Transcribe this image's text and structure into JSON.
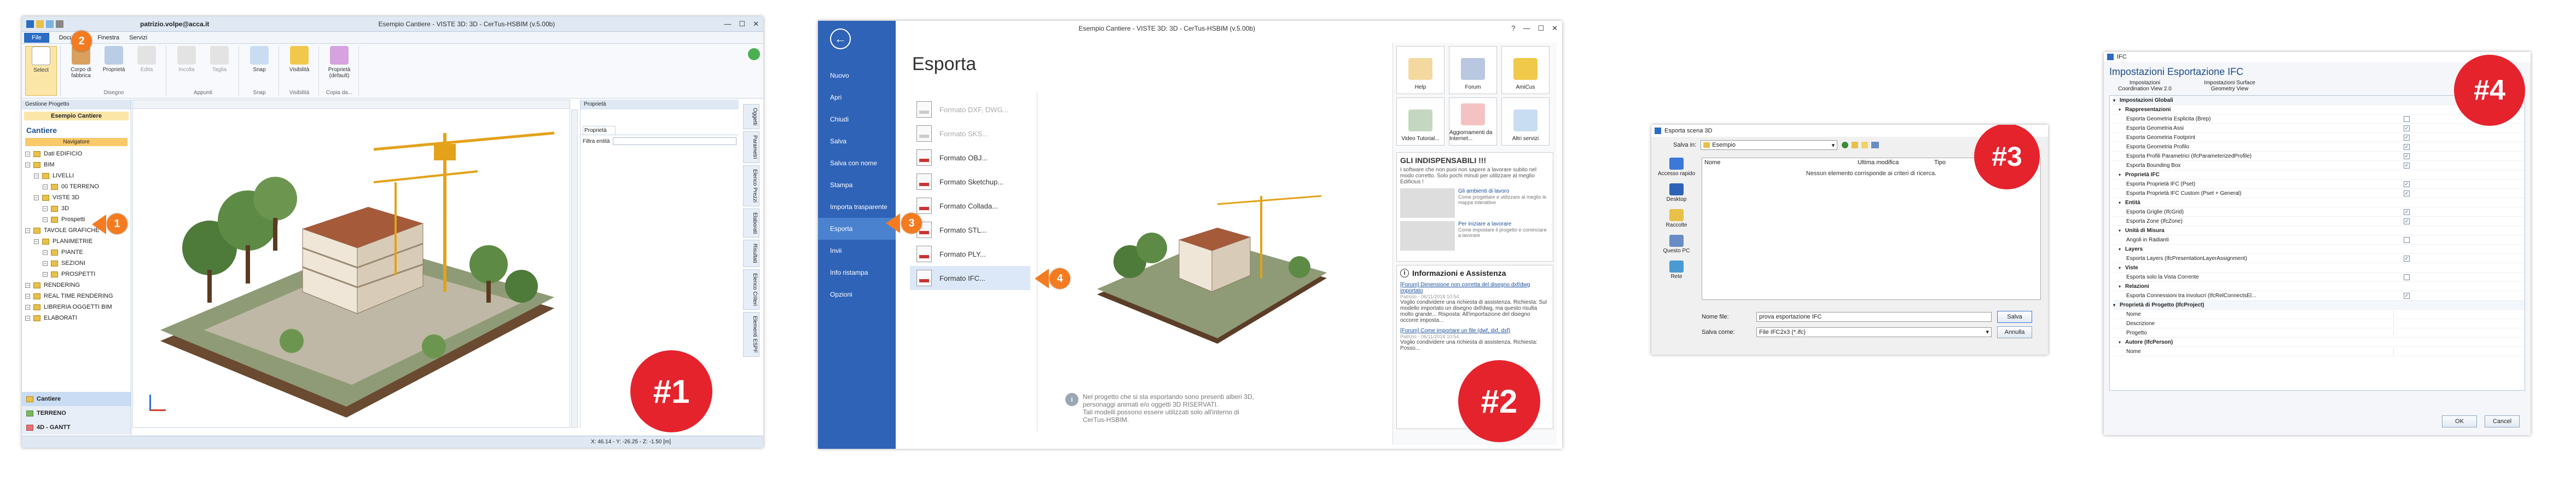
{
  "panel1": {
    "user": "patrizio.volpe@acca.it",
    "title": "Esempio Cantiere - VISTE 3D: 3D - CerTus-HSBIM (v.5.00b)",
    "tabs": [
      "File",
      "Documenti",
      "Finestra",
      "Servizi"
    ],
    "ribbon": {
      "groups": [
        {
          "label": "",
          "buttons": [
            "Select"
          ]
        },
        {
          "label": "Disegno",
          "buttons": [
            "Corpo di fabbrica",
            "Proprietà",
            "Edita"
          ]
        },
        {
          "label": "Appunti",
          "buttons": [
            "Incolla",
            "Taglia"
          ]
        },
        {
          "label": "Snap",
          "buttons": [
            "Snap"
          ]
        },
        {
          "label": "Visibilità",
          "buttons": [
            "Visibilità"
          ]
        },
        {
          "label": "Copia da...",
          "buttons": [
            "Proprietà (default)"
          ]
        }
      ]
    },
    "left_panel": {
      "header": "Gestione Progetto",
      "project": "Esempio Cantiere",
      "section_title": "Cantiere",
      "nav_tab": "Navigatore",
      "tree": [
        {
          "label": "Dati EDIFICIO",
          "level": 0
        },
        {
          "label": "BIM",
          "level": 0
        },
        {
          "label": "LIVELLI",
          "level": 1
        },
        {
          "label": "00 TERRENO",
          "level": 2
        },
        {
          "label": "VISTE 3D",
          "level": 1
        },
        {
          "label": "3D",
          "level": 2
        },
        {
          "label": "Prospetti",
          "level": 2
        },
        {
          "label": "TAVOLE GRAFICHE",
          "level": 0
        },
        {
          "label": "PLANIMETRIE",
          "level": 1
        },
        {
          "label": "PIANTE",
          "level": 2
        },
        {
          "label": "SEZIONI",
          "level": 2
        },
        {
          "label": "PROSPETTI",
          "level": 2
        },
        {
          "label": "RENDERING",
          "level": 0
        },
        {
          "label": "REAL TIME RENDERING",
          "level": 0
        },
        {
          "label": "LIBRERIA OGGETTI BIM",
          "level": 0
        },
        {
          "label": "ELABORATI",
          "level": 0
        }
      ],
      "bottom_items": [
        "Cantiere",
        "TERRENO",
        "4D - GANTT"
      ]
    },
    "properties": {
      "header": "Proprietà",
      "tab": "Proprietà",
      "filter_label": "Filtra entità"
    },
    "right_tabs": [
      "Oggetti",
      "Parametri",
      "Elenco Prezzi",
      "Elaborati",
      "Risultati",
      "Elenco Criteri",
      "Elementi ESPF"
    ],
    "status": "X: 46.14 - Y: -26.25 - Z: -1.50 [m]",
    "steps": [
      "1",
      "2"
    ],
    "badge": "#1"
  },
  "panel2": {
    "title": "Esempio Cantiere - VISTE 3D: 3D - CerTus-HSBIM (v.5.00b)",
    "heading": "Esporta",
    "menu": [
      "Nuovo",
      "Apri",
      "Chiudi",
      "Salva",
      "Salva con nome",
      "Stampa",
      "Importa trasparente",
      "Esporta",
      "Invii",
      "Info ristampa",
      "Opzioni"
    ],
    "formats": [
      {
        "label": "Formato DXF, DWG...",
        "enabled": false
      },
      {
        "label": "Formato SKS...",
        "enabled": false
      },
      {
        "label": "Formato OBJ...",
        "enabled": true
      },
      {
        "label": "Formato Sketchup...",
        "enabled": true
      },
      {
        "label": "Formato Collada...",
        "enabled": true
      },
      {
        "label": "Formato STL...",
        "enabled": true
      },
      {
        "label": "Formato PLY...",
        "enabled": true
      },
      {
        "label": "Formato IFC...",
        "enabled": true
      }
    ],
    "info_text_1": "Nel progetto che si sta esportando sono presenti alberi 3D, personaggi animati e/o oggetti 3D RISERVATI.",
    "info_text_2": "Tali modelli possono essere utilizzati solo all'interno di CerTus-HSBIM.",
    "tiles": [
      {
        "label": "Help"
      },
      {
        "label": "Forum"
      },
      {
        "label": "AmiCus"
      },
      {
        "label": "Video Tutorial..."
      },
      {
        "label": "Aggiornamenti da Internet..."
      },
      {
        "label": "Altri servizi"
      }
    ],
    "indispensabili_title": "GLI INDISPENSABILI !!!",
    "indispensabili_text": "I software che non puoi non sapere a lavorare subito nel modo corretto. Solo pochi minuti per utilizzare al meglio Edificius !",
    "card1": "Gli ambienti di lavoro",
    "card1_text": "Come progettare e utilizzare al meglio le mappe interattive",
    "card2": "Per iniziare a lavorare",
    "card2_text": "Come impostare il progetto e cominciare a lavorare",
    "news_title": "Informazioni e Assistenza",
    "news": [
      {
        "link": "[Forum] Dimensione non corretta del disegno dxf/dwg importato",
        "author": "Patrizio - 06/11/2018 10:54",
        "text": "Voglio condividere una richiesta di assistenza. Richiesta: Sul modello importato un disegno dxf/dwg, ma questo risulta molto grande... Risposta: All'importazione del disegno occorre imposta..."
      },
      {
        "link": "[Forum] Come importare un file (dwf, dxf, dxf)",
        "author": "Patrizio - 06/11/2018 10:54",
        "text": "Voglio condividere una richiesta di assistenza. Richiesta: Posso..."
      }
    ],
    "steps": [
      "3",
      "4"
    ],
    "badge": "#2"
  },
  "panel3": {
    "title": "Esporta scena 3D",
    "save_in_label": "Salva in:",
    "save_in_value": "Esempio",
    "columns": [
      "Nome",
      "Ultima modifica",
      "Tipo"
    ],
    "empty_message": "Nessun elemento corrisponde ai criteri di ricerca.",
    "places": [
      "Accesso rapido",
      "Desktop",
      "Raccolte",
      "Questo PC",
      "Rete"
    ],
    "filename_label": "Nome file:",
    "filename_value": "prova esportazione IFC",
    "filetype_label": "Salva come:",
    "filetype_value": "File IFC2x3 (*.ifc)",
    "save_button": "Salva",
    "cancel_button": "Annulla",
    "badge": "#3"
  },
  "panel4": {
    "title": "IFC",
    "heading": "Impostazioni Esportazione IFC",
    "header_tabs": [
      {
        "label": "Impostazioni Coordination View 2.0"
      },
      {
        "label": "Impostazioni Surface Geometry View"
      }
    ],
    "rows": [
      {
        "label": "Impostazioni Globali",
        "type": "group",
        "checked": null
      },
      {
        "label": "Rappresentazioni",
        "type": "sub",
        "checked": null
      },
      {
        "label": "Esporta Geometria Esplicita (Brep)",
        "type": "row",
        "checked": false
      },
      {
        "label": "Esporta Geometria Assi",
        "type": "row",
        "checked": true
      },
      {
        "label": "Esporta Geometria Footprint",
        "type": "row",
        "checked": true
      },
      {
        "label": "Esporta Geometria Profilo",
        "type": "row",
        "checked": true
      },
      {
        "label": "Esporta Profili Parametrici (IfcParameterizedProfile)",
        "type": "row",
        "checked": true
      },
      {
        "label": "Esporta Bounding Box",
        "type": "row",
        "checked": true
      },
      {
        "label": "Proprietà IFC",
        "type": "sub",
        "checked": null
      },
      {
        "label": "Esporta Proprietà IFC (Pset)",
        "type": "row",
        "checked": true
      },
      {
        "label": "Esporta Proprietà IFC Custom (Pset + General)",
        "type": "row",
        "checked": true
      },
      {
        "label": "Entità",
        "type": "sub",
        "checked": null
      },
      {
        "label": "Esporta Griglie (IfcGrid)",
        "type": "row",
        "checked": true
      },
      {
        "label": "Esporta Zone (IfcZone)",
        "type": "row",
        "checked": true
      },
      {
        "label": "Unità di Misura",
        "type": "sub",
        "checked": null
      },
      {
        "label": "Angoli in Radianti",
        "type": "row",
        "checked": false
      },
      {
        "label": "Layers",
        "type": "sub",
        "checked": null
      },
      {
        "label": "Esporta Layers (IfcPresentationLayerAssignment)",
        "type": "row",
        "checked": true
      },
      {
        "label": "Viste",
        "type": "sub",
        "checked": null
      },
      {
        "label": "Esporta solo la Vista Corrente",
        "type": "row",
        "checked": false
      },
      {
        "label": "Relazioni",
        "type": "sub",
        "checked": null
      },
      {
        "label": "Esporta Connessioni tra involucri (IfcRelConnectsEl...",
        "type": "row",
        "checked": true
      },
      {
        "label": "Proprietà di Progetto (IfcProject)",
        "type": "group",
        "checked": null
      },
      {
        "label": "Nome",
        "type": "field",
        "checked": null
      },
      {
        "label": "Descrizione",
        "type": "field",
        "checked": null
      },
      {
        "label": "Progetto",
        "type": "field",
        "checked": null
      },
      {
        "label": "Autore (IfcPerson)",
        "type": "sub",
        "checked": null
      },
      {
        "label": "Nome",
        "type": "field",
        "checked": null
      }
    ],
    "ok_button": "OK",
    "cancel_button": "Cancel",
    "badge": "#4"
  },
  "colors": {
    "accent_blue": "#2b6cc4",
    "backstage_blue": "#2f63b7",
    "step_orange": "#f47b20",
    "badge_red": "#e5232d"
  }
}
